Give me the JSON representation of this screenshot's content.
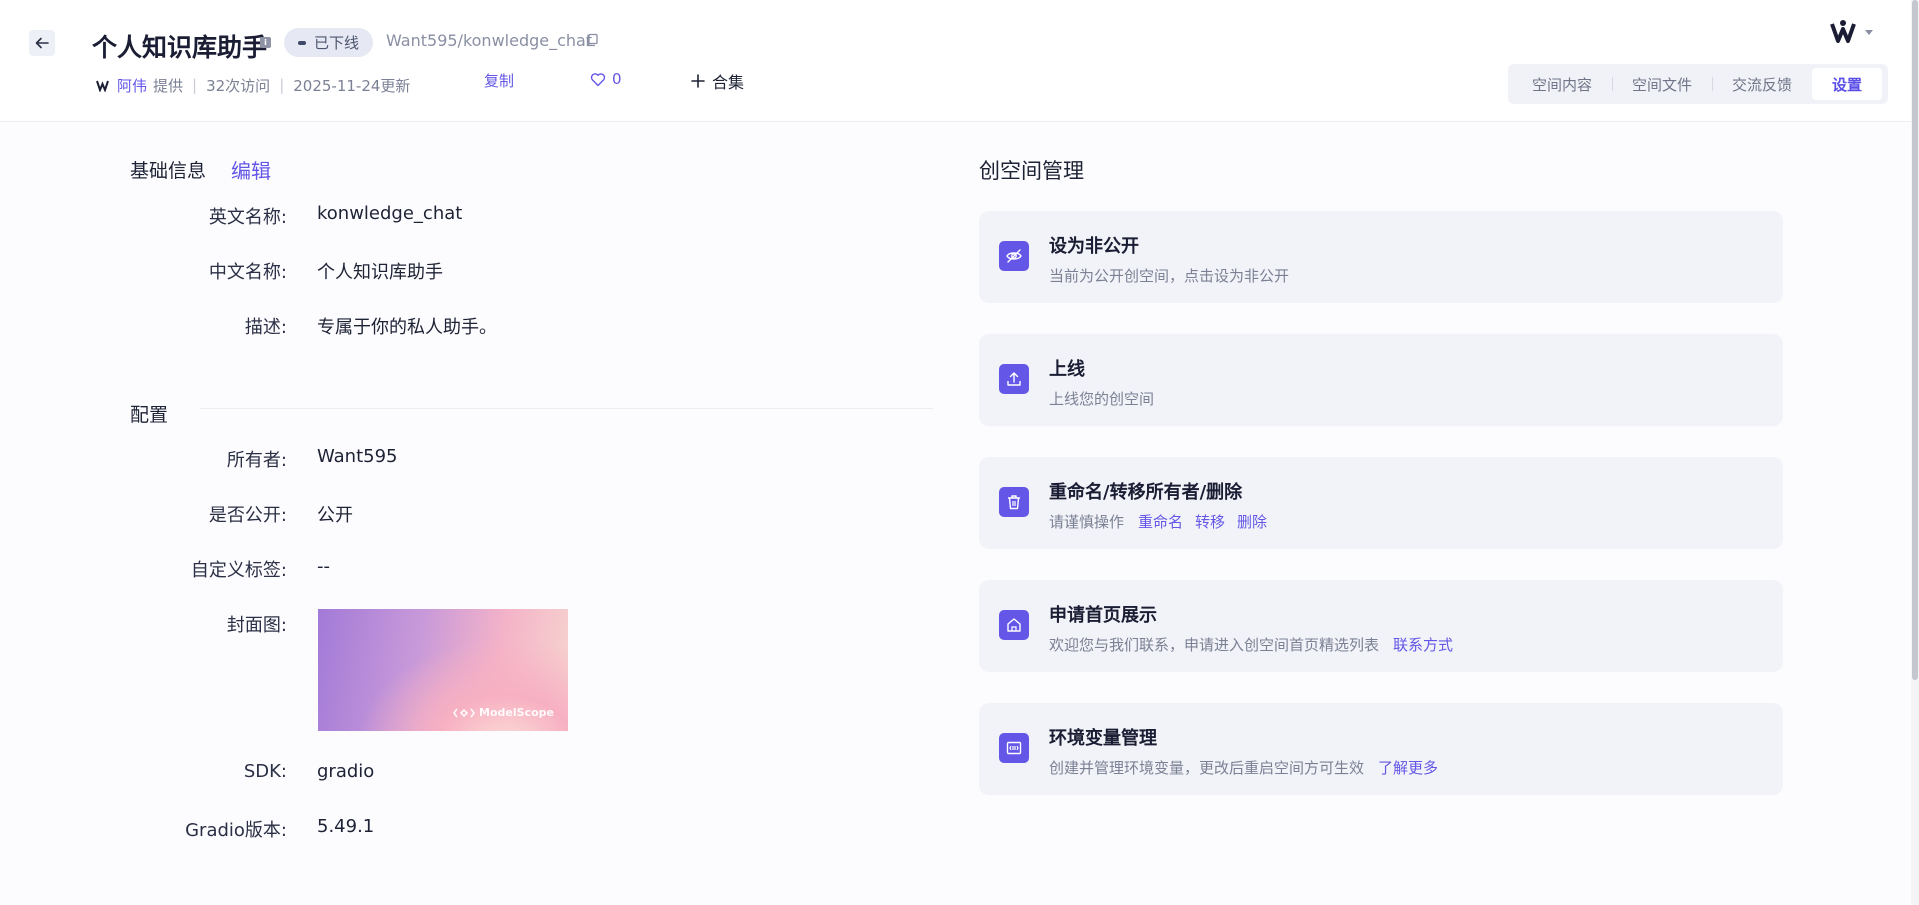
{
  "header": {
    "title": "个人知识库助手",
    "status": "已下线",
    "repo_path": "Want595/konwledge_chat",
    "author": "阿伟",
    "provided": "提供",
    "visits": "32次访问",
    "updated": "2025-11-24更新",
    "copy_label": "复制",
    "likes": "0",
    "collection_label": "合集"
  },
  "tabs": [
    {
      "label": "空间内容"
    },
    {
      "label": "空间文件"
    },
    {
      "label": "交流反馈"
    },
    {
      "label": "设置"
    }
  ],
  "basic_info": {
    "title": "基础信息",
    "edit_label": "编辑",
    "rows": [
      {
        "label": "英文名称:",
        "value": "konwledge_chat"
      },
      {
        "label": "中文名称:",
        "value": "个人知识库助手"
      },
      {
        "label": "描述:",
        "value": "专属于你的私人助手。"
      }
    ]
  },
  "config": {
    "title": "配置",
    "rows": [
      {
        "label": "所有者:",
        "value": "Want595"
      },
      {
        "label": "是否公开:",
        "value": "公开"
      },
      {
        "label": "自定义标签:",
        "value": "--"
      },
      {
        "label": "封面图:",
        "value": ""
      },
      {
        "label": "SDK:",
        "value": "gradio"
      },
      {
        "label": "Gradio版本:",
        "value": "5.49.1"
      }
    ],
    "cover_brand": "ModelScope"
  },
  "management": {
    "title": "创空间管理",
    "cards": [
      {
        "title": "设为非公开",
        "desc": "当前为公开创空间，点击设为非公开",
        "icon": "eye-off-icon"
      },
      {
        "title": "上线",
        "desc": "上线您的创空间",
        "icon": "upload-icon"
      },
      {
        "title": "重命名/转移所有者/删除",
        "desc": "请谨慎操作",
        "links": [
          "重命名",
          "转移",
          "删除"
        ],
        "icon": "trash-icon"
      },
      {
        "title": "申请首页展示",
        "desc": "欢迎您与我们联系，申请进入创空间首页精选列表",
        "links": [
          "联系方式"
        ],
        "icon": "home-icon"
      },
      {
        "title": "环境变量管理",
        "desc": "创建并管理环境变量，更改后重启空间方可生效",
        "links": [
          "了解更多"
        ],
        "icon": "variable-icon"
      }
    ]
  },
  "colors": {
    "accent": "#6456e6",
    "card_bg": "#f2f3f8",
    "text": "#1e2235",
    "muted": "#7b8094"
  }
}
